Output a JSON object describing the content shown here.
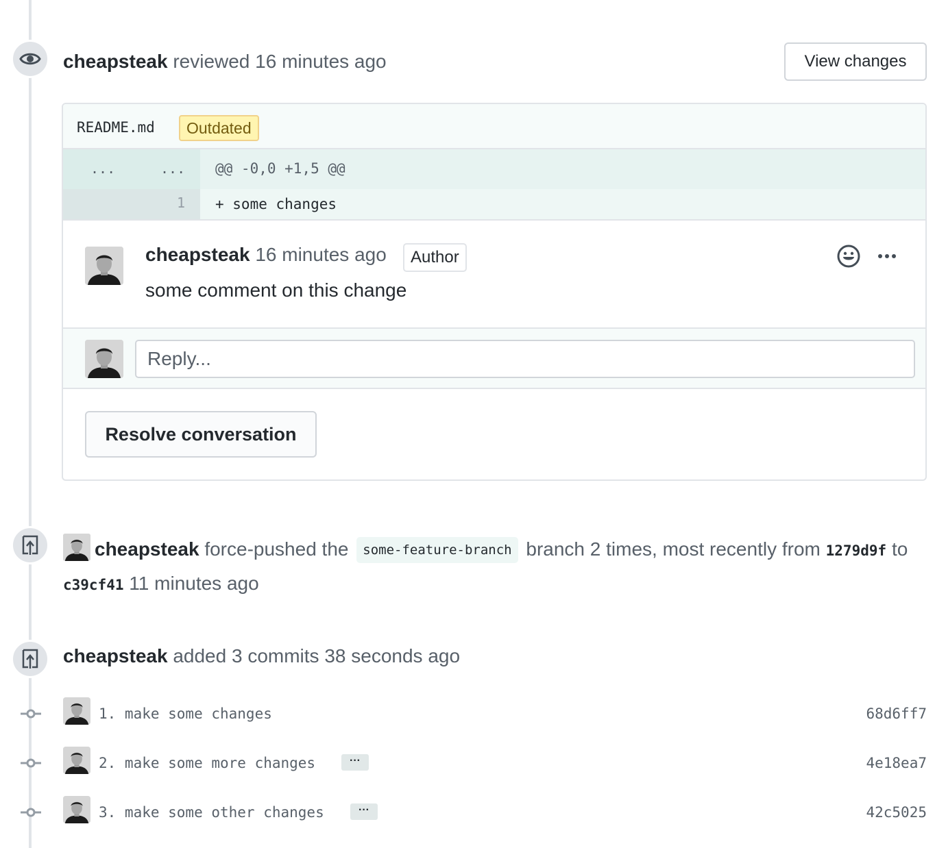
{
  "review": {
    "author": "cheapsteak",
    "action": "reviewed",
    "time": "16 minutes ago",
    "view_changes_label": "View changes",
    "file": {
      "name": "README.md",
      "outdated_label": "Outdated",
      "hunk_dots_left": "...",
      "hunk_dots_right": "...",
      "hunk_header": "@@ -0,0 +1,5 @@",
      "line_number": "1",
      "line_text": "+ some changes"
    },
    "comment": {
      "author": "cheapsteak",
      "time": "16 minutes ago",
      "author_badge": "Author",
      "body": "some comment on this change"
    },
    "reply_placeholder": "Reply...",
    "resolve_label": "Resolve conversation"
  },
  "force_push": {
    "author": "cheapsteak",
    "text_before_branch": "force-pushed the",
    "branch": "some-feature-branch",
    "text_after_branch": "branch 2 times, most recently from",
    "from_sha": "1279d9f",
    "to_word": "to",
    "to_sha": "c39cf41",
    "time": "11 minutes ago"
  },
  "commits_event": {
    "author": "cheapsteak",
    "action": "added 3 commits",
    "time": "38 seconds ago",
    "commits": [
      {
        "message": "1. make some changes",
        "sha": "68d6ff7",
        "has_more": false
      },
      {
        "message": "2. make some more changes",
        "sha": "4e18ea7",
        "has_more": true
      },
      {
        "message": "3. make some other changes",
        "sha": "42c5025",
        "has_more": true
      }
    ],
    "more_label": "···"
  },
  "icons": {
    "review": "eye-icon",
    "push": "repo-push-icon",
    "commit": "git-commit-icon",
    "emoji": "smiley-icon",
    "more": "kebab-horizontal-icon"
  },
  "colors": {
    "timeline": "#e1e4e8",
    "outdated_bg": "#fff5b1",
    "diff_bg": "#eef7f5",
    "text_muted": "#586069"
  }
}
